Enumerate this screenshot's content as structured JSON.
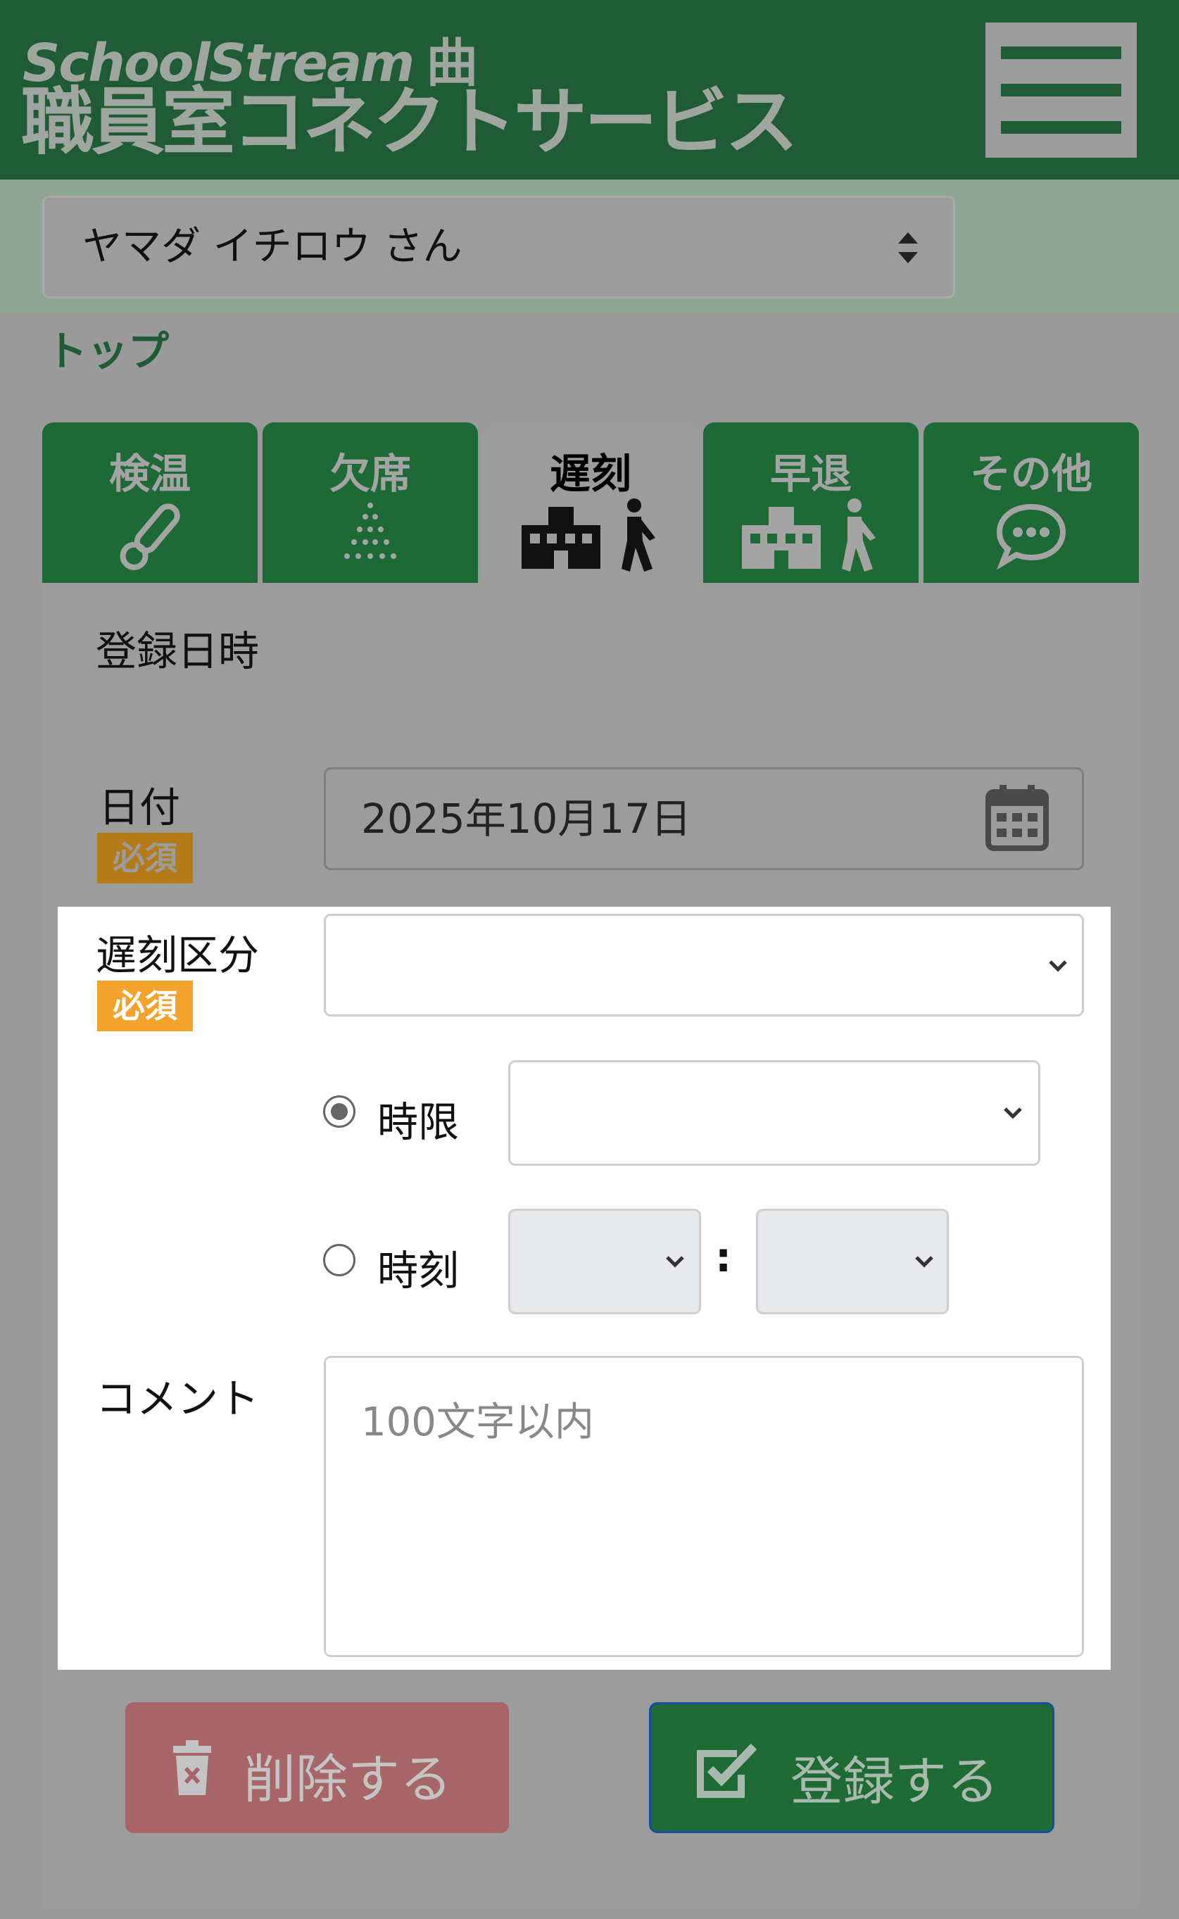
{
  "header": {
    "brand": "SchoolStream",
    "title": "職員室コネクトサービス"
  },
  "user_select": {
    "value": "ヤマダ イチロウ さん"
  },
  "breadcrumb": "トップ",
  "tabs": [
    {
      "label": "検温",
      "icon": "thermometer-icon",
      "active": false
    },
    {
      "label": "欠席",
      "icon": "absence-dots-icon",
      "active": false
    },
    {
      "label": "遅刻",
      "icon": "school-walker-icon",
      "active": true
    },
    {
      "label": "早退",
      "icon": "school-walker-icon",
      "active": false
    },
    {
      "label": "その他",
      "icon": "speech-bubble-icon",
      "active": false
    }
  ],
  "form": {
    "section_title": "登録日時",
    "date_label": "日付",
    "required_badge": "必須",
    "date_value": "2025年10月17日",
    "late_type_label": "遅刻区分",
    "late_type_value": "",
    "period_option_label": "時限",
    "period_selected": true,
    "time_option_label": "時刻",
    "time_separator": ":",
    "comment_label": "コメント",
    "comment_placeholder": "100文字以内"
  },
  "buttons": {
    "delete": "削除する",
    "register": "登録する"
  },
  "colors": {
    "header_green": "#1f5c36",
    "tab_green": "#1d6a37",
    "required_orange": "#f3a32c",
    "delete_red": "#a86567"
  }
}
